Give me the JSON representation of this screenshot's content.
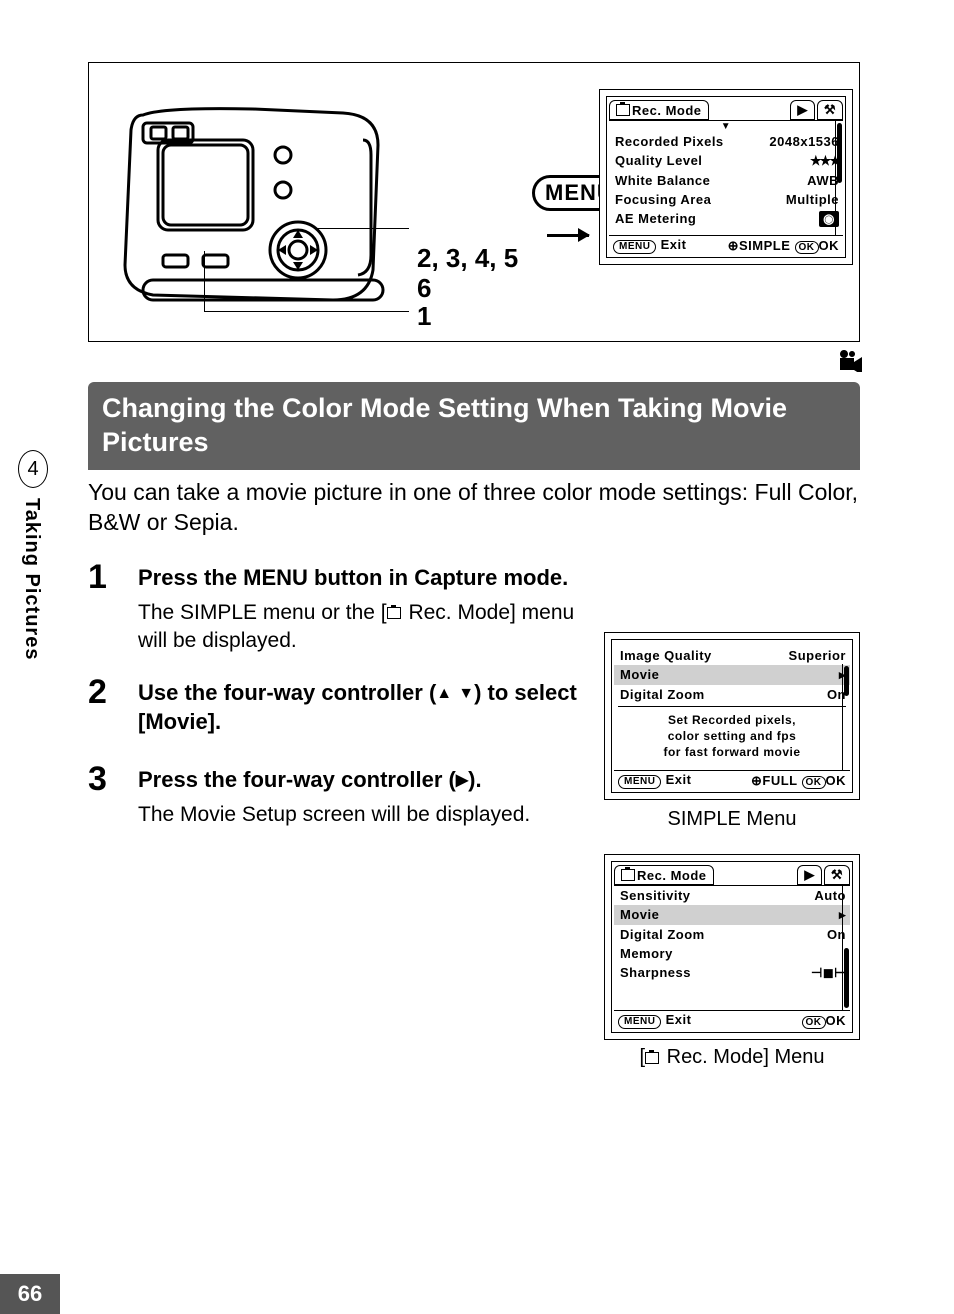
{
  "side": {
    "chapter_num": "4",
    "chapter_label": "Taking Pictures"
  },
  "page_number": "66",
  "top": {
    "menu_badge": "MENU",
    "callout_a": "2, 3, 4, 5",
    "callout_b": "6",
    "callout_c": "1"
  },
  "lcd_top": {
    "tab_title": "Rec. Mode",
    "rows": [
      {
        "k": "Recorded Pixels",
        "v": "2048x1536"
      },
      {
        "k": "Quality Level",
        "v": "★★★"
      },
      {
        "k": "White Balance",
        "v": "AWB"
      },
      {
        "k": "Focusing Area",
        "v": "Multiple"
      },
      {
        "k": "AE Metering",
        "v": ""
      }
    ],
    "footer_left_badge": "MENU",
    "footer_left": "Exit",
    "footer_mid": "SIMPLE",
    "footer_right_badge": "OK",
    "footer_right": "OK"
  },
  "heading": "Changing the Color Mode Setting When Taking Movie Pictures",
  "intro": "You can take a movie picture in one of three color mode settings: Full Color, B&W or Sepia.",
  "steps": [
    {
      "n": "1",
      "bold": "Press the MENU button in Capture mode.",
      "desc_pre": "The SIMPLE menu or the [",
      "desc_post": " Rec. Mode] menu will be displayed."
    },
    {
      "n": "2",
      "bold_pre": "Use the four-way controller (",
      "bold_post": ") to select [Movie].",
      "desc": ""
    },
    {
      "n": "3",
      "bold_pre": "Press the four-way controller (",
      "bold_post": ").",
      "desc": "The Movie Setup screen will be displayed."
    }
  ],
  "lcd_simple": {
    "rows": [
      {
        "k": "Image Quality",
        "v": "Superior"
      },
      {
        "k": "Movie",
        "v": "",
        "hl": true
      },
      {
        "k": "Digital Zoom",
        "v": "On"
      }
    ],
    "hint_l1": "Set Recorded pixels,",
    "hint_l2": "color setting and fps",
    "hint_l3": "for fast forward movie",
    "footer_left_badge": "MENU",
    "footer_left": "Exit",
    "footer_mid": "FULL",
    "footer_right_badge": "OK",
    "footer_right": "OK",
    "caption": "SIMPLE Menu"
  },
  "lcd_rec": {
    "tab_title": "Rec. Mode",
    "rows": [
      {
        "k": "Sensitivity",
        "v": "Auto"
      },
      {
        "k": "Movie",
        "v": "",
        "hl": true
      },
      {
        "k": "Digital Zoom",
        "v": "On"
      },
      {
        "k": "Memory",
        "v": ""
      },
      {
        "k": "Sharpness",
        "v": ""
      }
    ],
    "footer_left_badge": "MENU",
    "footer_left": "Exit",
    "footer_right_badge": "OK",
    "footer_right": "OK",
    "caption_pre": "[",
    "caption_post": " Rec. Mode] Menu"
  }
}
